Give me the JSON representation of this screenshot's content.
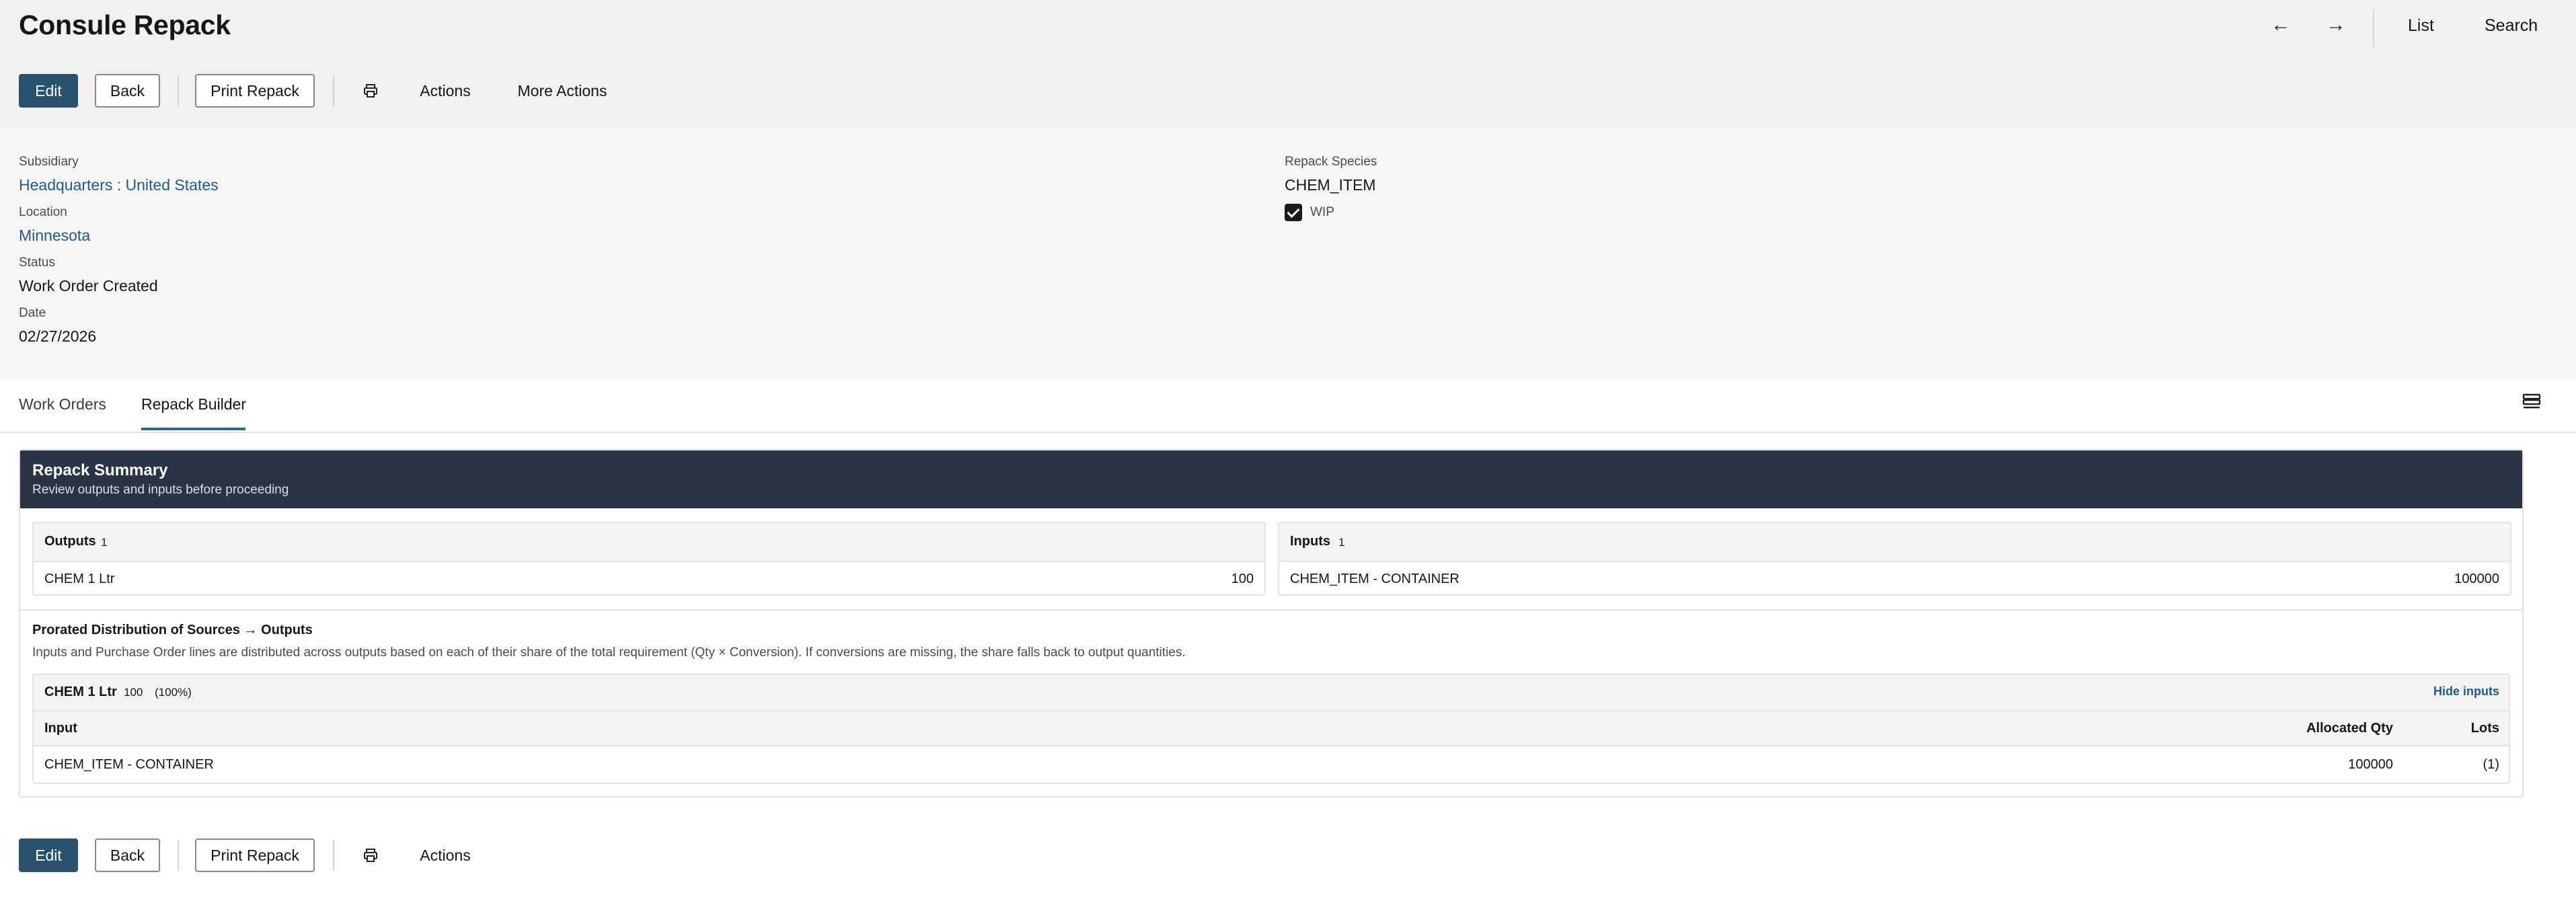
{
  "page": {
    "title": "Consule Repack"
  },
  "nav": {
    "prev_icon": "←",
    "next_icon": "→",
    "list_label": "List",
    "search_label": "Search"
  },
  "toolbar": {
    "edit_label": "Edit",
    "back_label": "Back",
    "print_repack_label": "Print Repack",
    "actions_label": "Actions",
    "more_actions_label": "More Actions"
  },
  "fields": {
    "subsidiary_label": "Subsidiary",
    "subsidiary_value": "Headquarters : United States",
    "location_label": "Location",
    "location_value": "Minnesota",
    "status_label": "Status",
    "status_value": "Work Order Created",
    "date_label": "Date",
    "date_value": "02/27/2026",
    "repack_species_label": "Repack Species",
    "repack_species_value": "CHEM_ITEM",
    "wip_label": "WIP",
    "wip_checked": true
  },
  "tabs": [
    {
      "label": "Work Orders",
      "active": false
    },
    {
      "label": "Repack Builder",
      "active": true
    }
  ],
  "summary": {
    "title": "Repack Summary",
    "subtitle": "Review outputs and inputs before proceeding",
    "outputs": {
      "title": "Outputs",
      "count": "1",
      "rows": [
        {
          "name": "CHEM 1 Ltr",
          "value": "100"
        }
      ]
    },
    "inputs": {
      "title": "Inputs",
      "count": "1",
      "rows": [
        {
          "name": "CHEM_ITEM - CONTAINER",
          "value": "100000"
        }
      ]
    },
    "prorate_title": "Prorated Distribution of Sources → Outputs",
    "prorate_desc": "Inputs and Purchase Order lines are distributed across outputs based on each of their share of the total requirement (Qty × Conversion). If conversions are missing, the share falls back to output quantities.",
    "distribution": {
      "output_name": "CHEM 1 Ltr",
      "output_qty": "100",
      "output_pct": "(100%)",
      "toggle_label": "Hide inputs",
      "columns": {
        "input": "Input",
        "allocated_qty": "Allocated Qty",
        "lots": "Lots"
      },
      "rows": [
        {
          "input": "CHEM_ITEM - CONTAINER",
          "allocated_qty": "100000",
          "lots": "(1)"
        }
      ]
    }
  },
  "colors": {
    "primary": "#27526e",
    "link": "#1d5b8c",
    "header_dark": "#293546",
    "tab_accent": "#2a6a8f"
  },
  "icons": {
    "print": "printer-icon",
    "layout": "layout-toggle-icon"
  }
}
